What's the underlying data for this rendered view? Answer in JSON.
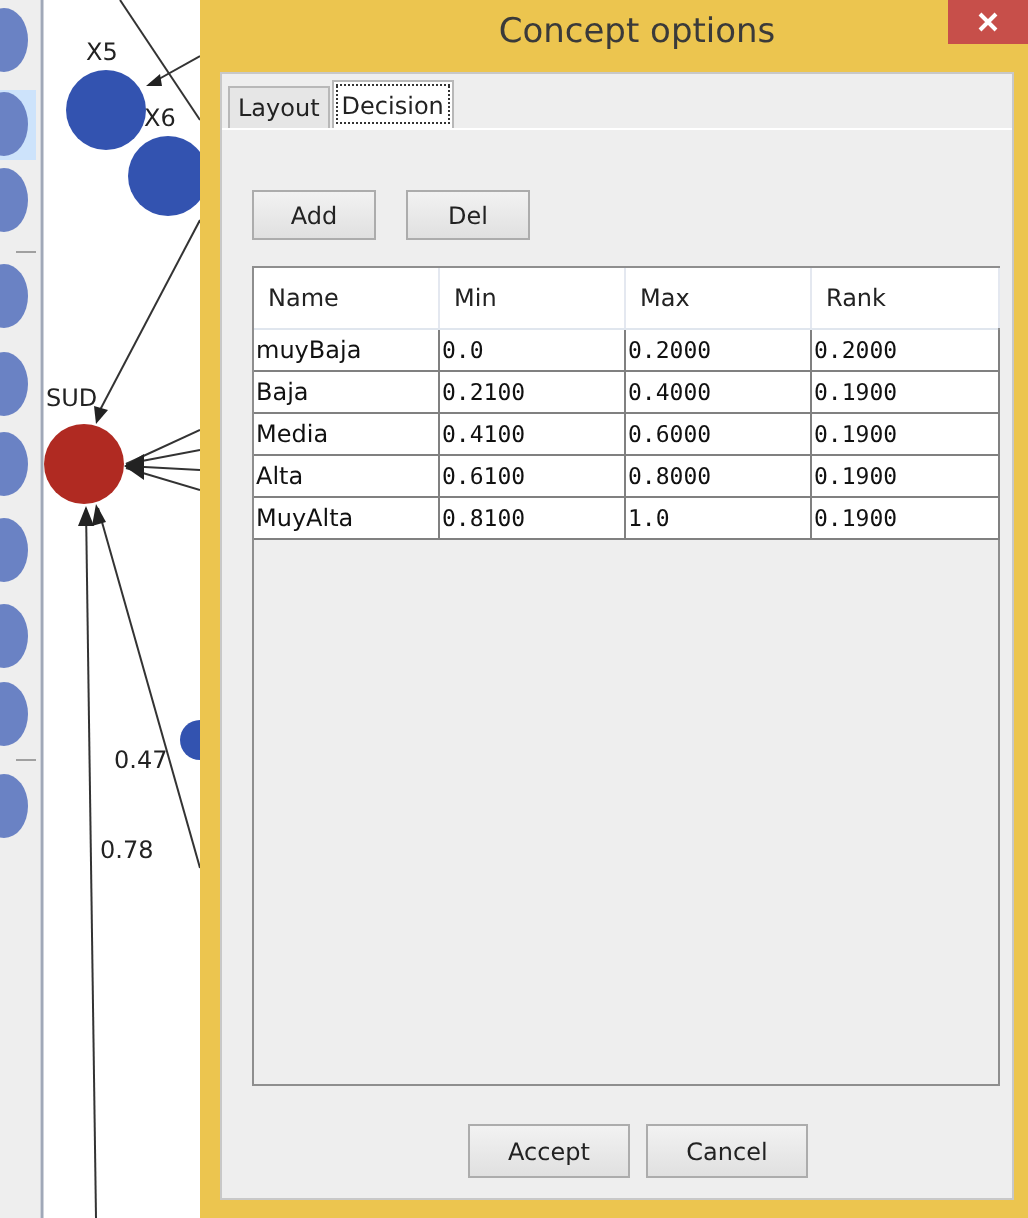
{
  "graph": {
    "nodes": [
      {
        "label": "X5",
        "color": "#3353b0"
      },
      {
        "label": "X6",
        "color": "#3353b0"
      },
      {
        "label": "SUD",
        "color": "#b02a22"
      }
    ],
    "edge_labels": [
      "0.47",
      "0.78"
    ]
  },
  "window": {
    "title": "Concept options"
  },
  "tabs": [
    {
      "label": "Layout",
      "selected": false
    },
    {
      "label": "Decision",
      "selected": true
    }
  ],
  "toolbar_buttons": [
    "Add",
    "Del"
  ],
  "table": {
    "columns": [
      "Name",
      "Min",
      "Max",
      "Rank"
    ],
    "rows": [
      [
        "muyBaja",
        "0.0",
        "0.2000",
        "0.2000"
      ],
      [
        "Baja",
        "0.2100",
        "0.4000",
        "0.1900"
      ],
      [
        "Media",
        "0.4100",
        "0.6000",
        "0.1900"
      ],
      [
        "Alta",
        "0.6100",
        "0.8000",
        "0.1900"
      ],
      [
        "MuyAlta",
        "0.8100",
        "1.0",
        "0.1900"
      ]
    ]
  },
  "buttons": [
    "Accept",
    "Cancel"
  ]
}
